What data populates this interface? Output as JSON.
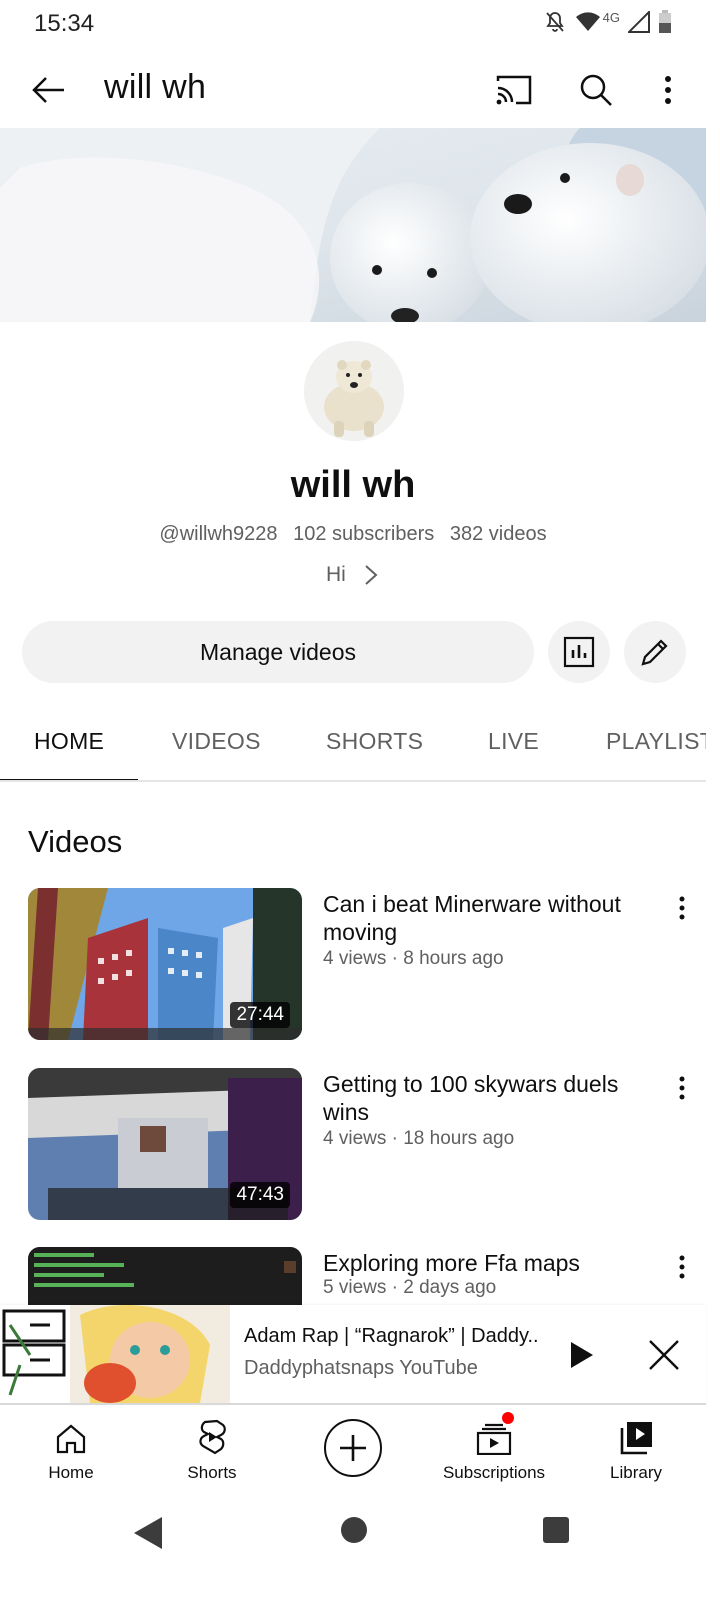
{
  "status_bar": {
    "time": "15:34",
    "network": "4G",
    "icons": [
      "bell-off-icon",
      "wifi-icon",
      "signal-icon",
      "battery-icon"
    ]
  },
  "app_bar": {
    "title": "will wh",
    "icons": [
      "back-arrow-icon",
      "cast-icon",
      "search-icon",
      "more-vert-icon"
    ]
  },
  "channel": {
    "name": "will wh",
    "handle": "@willwh9228",
    "subscribers": "102 subscribers",
    "videos_count": "382 videos",
    "description": "Hi"
  },
  "actions": {
    "manage_label": "Manage videos",
    "icons": [
      "analytics-icon",
      "edit-pencil-icon"
    ]
  },
  "tabs": [
    "HOME",
    "VIDEOS",
    "SHORTS",
    "LIVE",
    "PLAYLIST"
  ],
  "active_tab": "HOME",
  "section": {
    "title": "Videos",
    "videos": [
      {
        "title": "Can i beat Minerware without moving",
        "meta": "4 views · 8 hours ago",
        "duration": "27:44"
      },
      {
        "title": "Getting to 100 skywars duels wins",
        "meta": "4 views · 18 hours ago",
        "duration": "47:43"
      },
      {
        "title": "Exploring more Ffa maps",
        "meta": "5 views · 2 days ago",
        "duration": ""
      }
    ]
  },
  "mini_player": {
    "title": "Adam Rap | “Ragnarok” | Daddy..",
    "channel": "Daddyphatsnaps YouTube",
    "icons": [
      "play-icon",
      "close-icon"
    ]
  },
  "bottom_nav": {
    "items": [
      {
        "label": "Home",
        "icon": "home-icon"
      },
      {
        "label": "Shorts",
        "icon": "shorts-icon"
      },
      {
        "label": "",
        "icon": "create-plus-icon"
      },
      {
        "label": "Subscriptions",
        "icon": "subscriptions-icon"
      },
      {
        "label": "Library",
        "icon": "library-icon"
      }
    ]
  },
  "colors": {
    "accent": "#0f0f0f",
    "secondary_text": "#606060",
    "chip_bg": "#f2f2f2",
    "notification": "#ff0000"
  }
}
